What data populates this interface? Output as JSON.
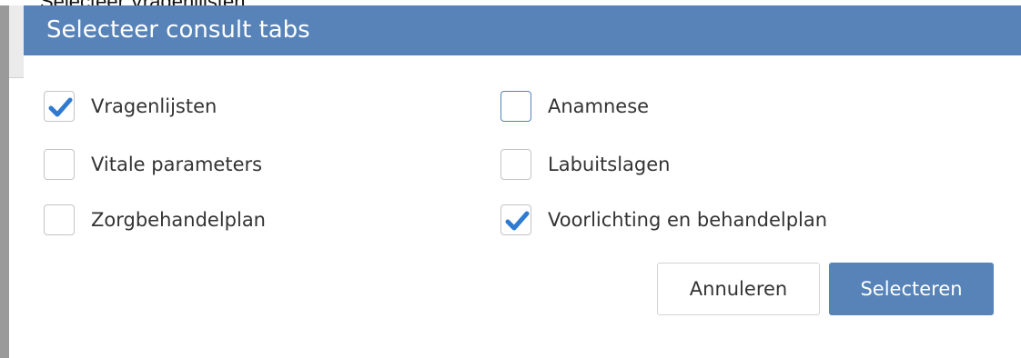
{
  "caption": "Selecteer Vragenlijsten.",
  "dialog": {
    "title": "Selecteer consult tabs",
    "options": [
      {
        "label": "Vragenlijsten",
        "checked": true
      },
      {
        "label": "Anamnese",
        "checked": false
      },
      {
        "label": "Vitale parameters",
        "checked": false
      },
      {
        "label": "Labuitslagen",
        "checked": false
      },
      {
        "label": "Zorgbehandelplan",
        "checked": false
      },
      {
        "label": "Voorlichting en behandelplan",
        "checked": true
      }
    ],
    "cancel_label": "Annuleren",
    "select_label": "Selecteren"
  },
  "colors": {
    "accent": "#5783b8",
    "check": "#2e7bd1",
    "checkbox_border": "#c4c4c4"
  },
  "icons": {
    "checkmark": "check-icon"
  }
}
